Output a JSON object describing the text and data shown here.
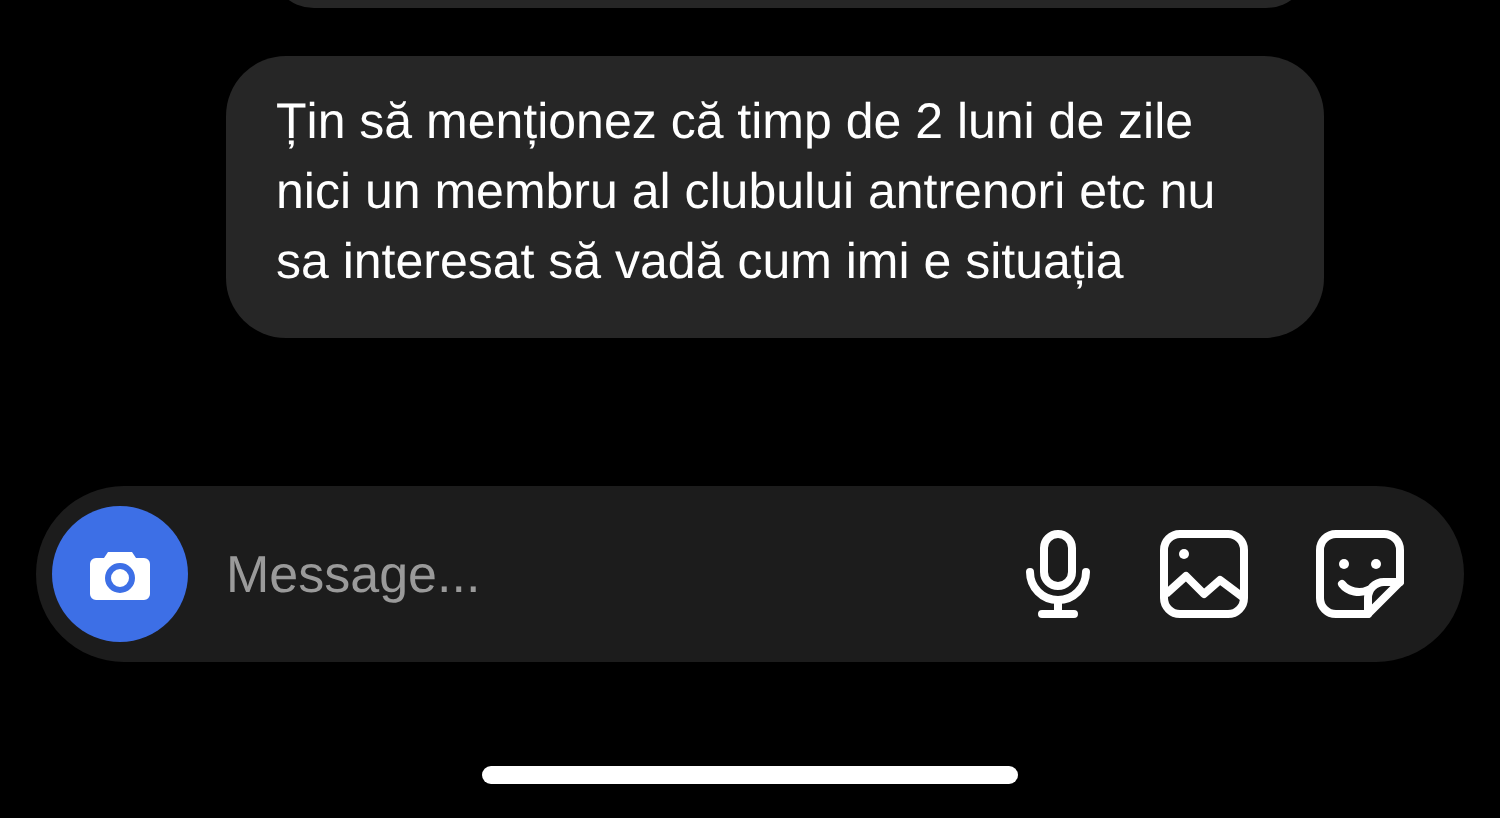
{
  "messages": [
    {
      "text": "Țin să menționez că timp de 2 luni de zile nici un membru al clubului antrenori etc nu sa interesat să vadă cum imi e situația"
    }
  ],
  "composer": {
    "placeholder": "Message..."
  }
}
